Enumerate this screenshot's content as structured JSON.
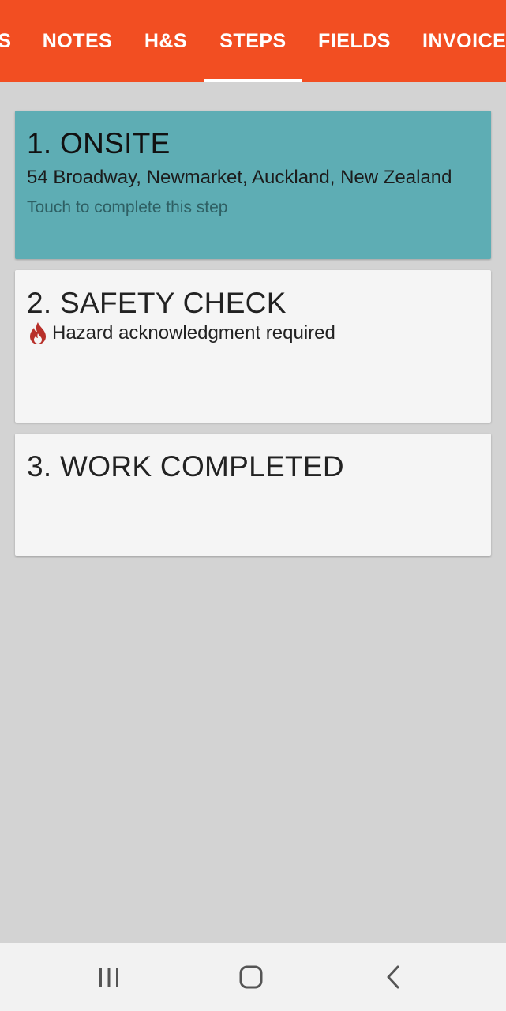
{
  "tabs": [
    {
      "label": "S"
    },
    {
      "label": "NOTES"
    },
    {
      "label": "H&S"
    },
    {
      "label": "STEPS",
      "selected": true
    },
    {
      "label": "FIELDS"
    },
    {
      "label": "INVOICE"
    }
  ],
  "colors": {
    "tab_bar": "#f24e22",
    "active_step": "#5eadb4",
    "card": "#f5f5f5",
    "background": "#d3d3d3",
    "hazard_icon": "#b8302a"
  },
  "steps": [
    {
      "title": "1. ONSITE",
      "address": "54 Broadway, Newmarket, Auckland, New Zealand",
      "hint": "Touch to complete this step",
      "active": true
    },
    {
      "title": "2. SAFETY CHECK",
      "hazard_text": "Hazard acknowledgment required",
      "icon": "flame-icon"
    },
    {
      "title": "3. WORK COMPLETED"
    }
  ],
  "system_nav": {
    "icons": [
      "recent-apps-icon",
      "home-icon",
      "back-icon"
    ]
  }
}
